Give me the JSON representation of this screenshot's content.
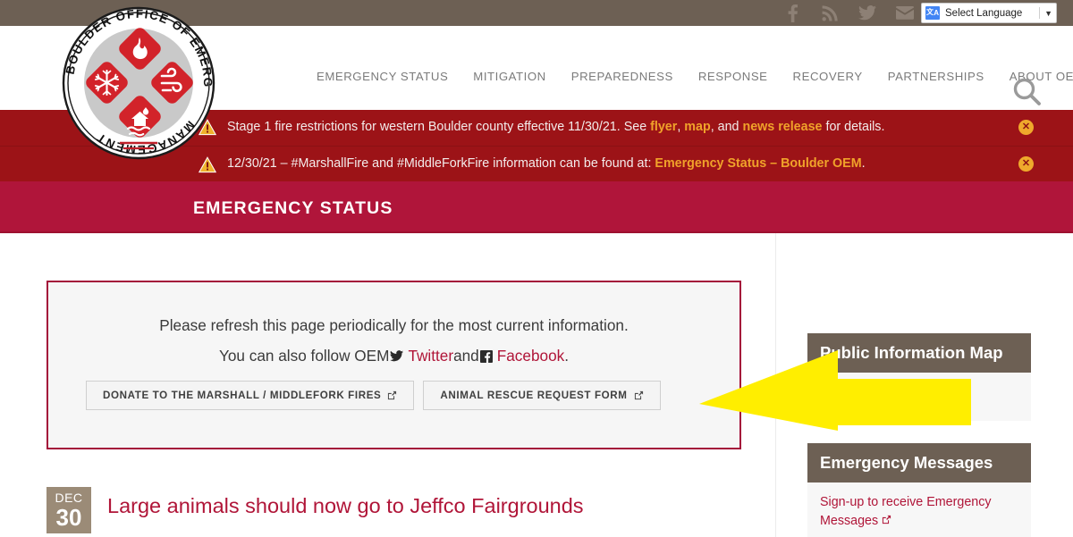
{
  "topbar": {
    "social": [
      {
        "name": "facebook-icon",
        "label": "Facebook"
      },
      {
        "name": "rss-icon",
        "label": "RSS"
      },
      {
        "name": "twitter-icon",
        "label": "Twitter"
      },
      {
        "name": "email-icon",
        "label": "Email"
      }
    ],
    "language": {
      "label": "Select Language",
      "caret": "▼",
      "icon": "google-translate-icon"
    },
    "bg": "#6d6054"
  },
  "header": {
    "logo_alt": "Boulder Office of Emergency Management",
    "logo_text": "BOULDER OFFICE OF EMERGENCY MANAGEMENT",
    "nav": [
      {
        "label": "EMERGENCY STATUS"
      },
      {
        "label": "MITIGATION"
      },
      {
        "label": "PREPAREDNESS"
      },
      {
        "label": "RESPONSE"
      },
      {
        "label": "RECOVERY"
      },
      {
        "label": "PARTNERSHIPS"
      },
      {
        "label": "ABOUT OEM"
      }
    ],
    "search_icon": "search-icon"
  },
  "alerts": {
    "bg": "#9c1317",
    "link_color": "#f0a22a",
    "items": [
      {
        "pre": "Stage 1 fire restrictions for western Boulder county effective 11/30/21. See ",
        "link1": "flyer",
        "mid1": ", ",
        "link2": "map",
        "mid2": ", and ",
        "link3": "news release",
        "post": " for details.",
        "close": "✕"
      },
      {
        "pre": "12/30/21 – #MarshallFire and #MiddleForkFire information can be found at: ",
        "link1": "Emergency Status – Boulder OEM",
        "post": ".",
        "close": "✕"
      }
    ]
  },
  "page_title": {
    "text": "EMERGENCY STATUS",
    "bg": "#b0153a"
  },
  "notice": {
    "border_color": "#a4123a",
    "line1": "Please refresh this page periodically for the most current information.",
    "line2_pre": "You can also follow OEM ",
    "twitter_link": "Twitter",
    "line2_mid": " and ",
    "facebook_link": "Facebook",
    "line2_post": ".",
    "buttons": [
      {
        "label": "DONATE TO THE MARSHALL / MIDDLEFORK FIRES",
        "icon": "external-link-icon"
      },
      {
        "label": "ANIMAL RESCUE REQUEST FORM",
        "icon": "external-link-icon"
      }
    ]
  },
  "news": {
    "date_month": "DEC",
    "date_day": "30",
    "title": "Large animals should now go to Jeffco Fairgrounds"
  },
  "sidebar": {
    "widgets": [
      {
        "title": "Public Information Map",
        "body": "",
        "icon": "external-link-icon"
      },
      {
        "title": "Emergency Messages",
        "body": "Sign-up to receive Emergency Messages",
        "icon": "external-link-icon"
      }
    ]
  },
  "annotation": {
    "arrow_color": "#ffee00",
    "arrow_direction": "left",
    "arrow_name": "yellow-pointer-arrow"
  }
}
